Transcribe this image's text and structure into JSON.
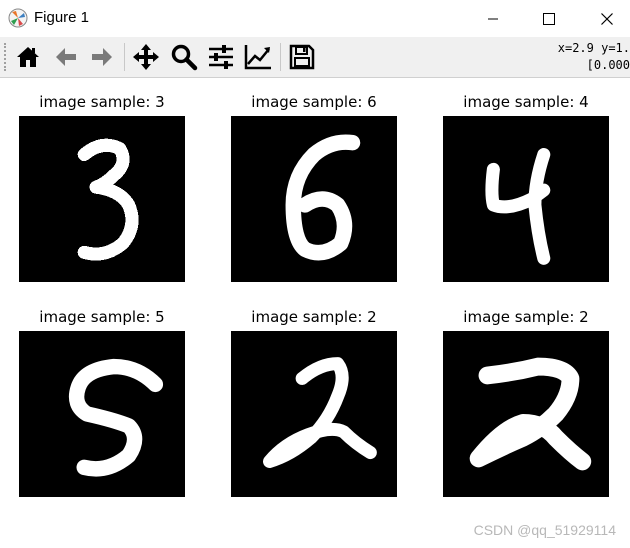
{
  "window": {
    "title": "Figure 1",
    "app_icon": "matplotlib-logo-icon",
    "controls": [
      "minimize-icon",
      "maximize-icon",
      "close-icon"
    ]
  },
  "toolbar": {
    "tools": [
      "home-icon",
      "back-arrow-icon",
      "forward-arrow-icon",
      "pan-move-icon",
      "zoom-magnifier-icon",
      "configure-subplots-icon",
      "edit-axes-icon",
      "save-disk-icon"
    ],
    "coord_line1": "x=2.9 y=1.",
    "coord_line2": "[0.000"
  },
  "figure": {
    "panels": [
      {
        "title": "image sample: 3",
        "digit": 3
      },
      {
        "title": "image sample: 6",
        "digit": 6
      },
      {
        "title": "image sample: 4",
        "digit": 4
      },
      {
        "title": "image sample: 5",
        "digit": 5
      },
      {
        "title": "image sample: 2",
        "digit": 2
      },
      {
        "title": "image sample: 2",
        "digit": 2
      }
    ],
    "image_background": "#000000",
    "stroke_color": "#ffffff"
  },
  "watermark": "CSDN @qq_51929114"
}
